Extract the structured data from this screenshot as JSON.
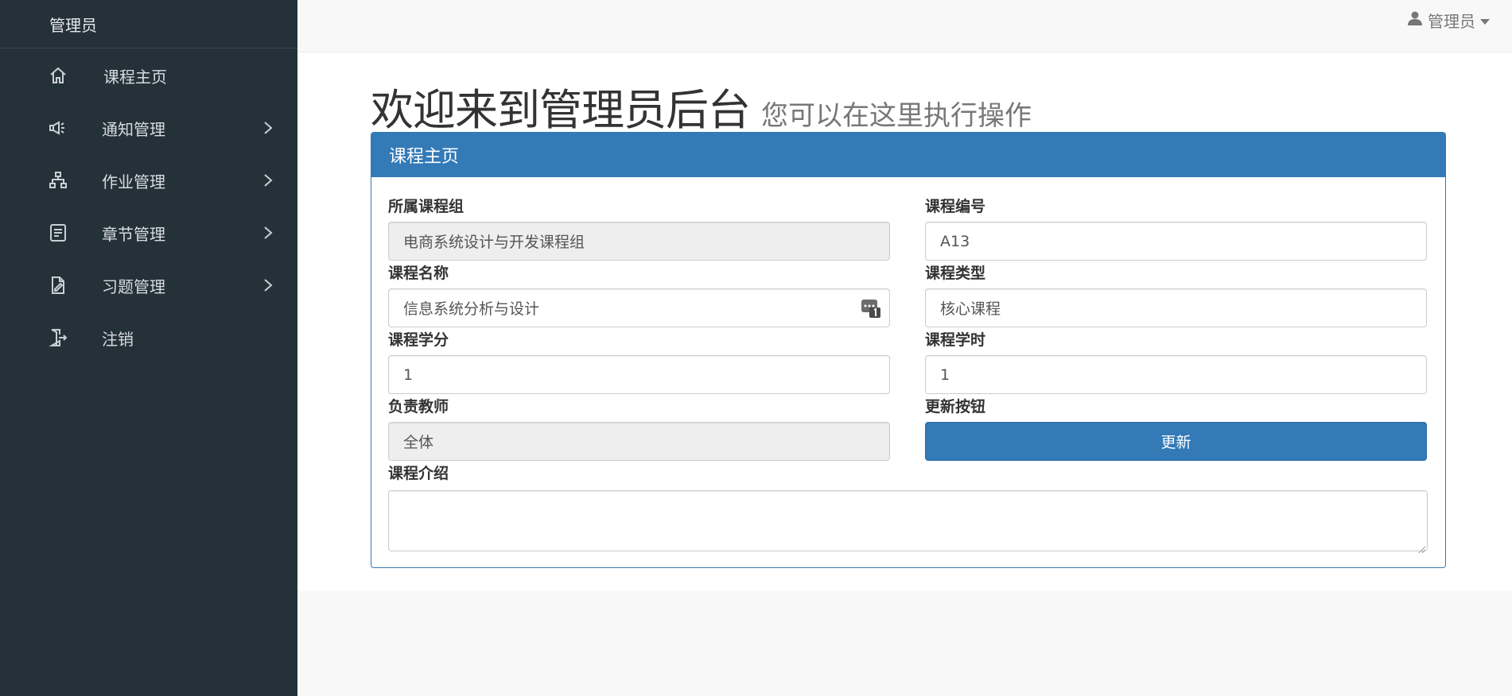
{
  "sidebar": {
    "brand": "管理员",
    "items": [
      {
        "label": "课程主页",
        "icon": "home-icon",
        "has_submenu": false
      },
      {
        "label": "通知管理",
        "icon": "megaphone-icon",
        "has_submenu": true
      },
      {
        "label": "作业管理",
        "icon": "sitemap-icon",
        "has_submenu": true
      },
      {
        "label": "章节管理",
        "icon": "document-list-icon",
        "has_submenu": true
      },
      {
        "label": "习题管理",
        "icon": "edit-document-icon",
        "has_submenu": true
      },
      {
        "label": "注销",
        "icon": "logout-door-icon",
        "has_submenu": false
      }
    ]
  },
  "topbar": {
    "user_label": "管理员",
    "user_icon": "user-icon",
    "caret_icon": "caret-down-icon"
  },
  "page": {
    "title": "欢迎来到管理员后台",
    "subtitle": "您可以在这里执行操作"
  },
  "panel": {
    "heading": "课程主页",
    "fields": {
      "course_group": {
        "label": "所属课程组",
        "value": "电商系统设计与开发课程组"
      },
      "course_code": {
        "label": "课程编号",
        "value": "A13"
      },
      "course_name": {
        "label": "课程名称",
        "value": "信息系统分析与设计"
      },
      "course_type": {
        "label": "课程类型",
        "value": "核心课程"
      },
      "credits": {
        "label": "课程学分",
        "value": "1"
      },
      "hours": {
        "label": "课程学时",
        "value": "1"
      },
      "teacher": {
        "label": "负责教师",
        "value": "全体"
      },
      "update": {
        "label": "更新按钮",
        "button": "更新"
      },
      "intro": {
        "label": "课程介绍",
        "value": ""
      }
    }
  },
  "colors": {
    "sidebar_bg": "#253139",
    "primary": "#337ab7",
    "readonly_bg": "#eeeeee"
  }
}
